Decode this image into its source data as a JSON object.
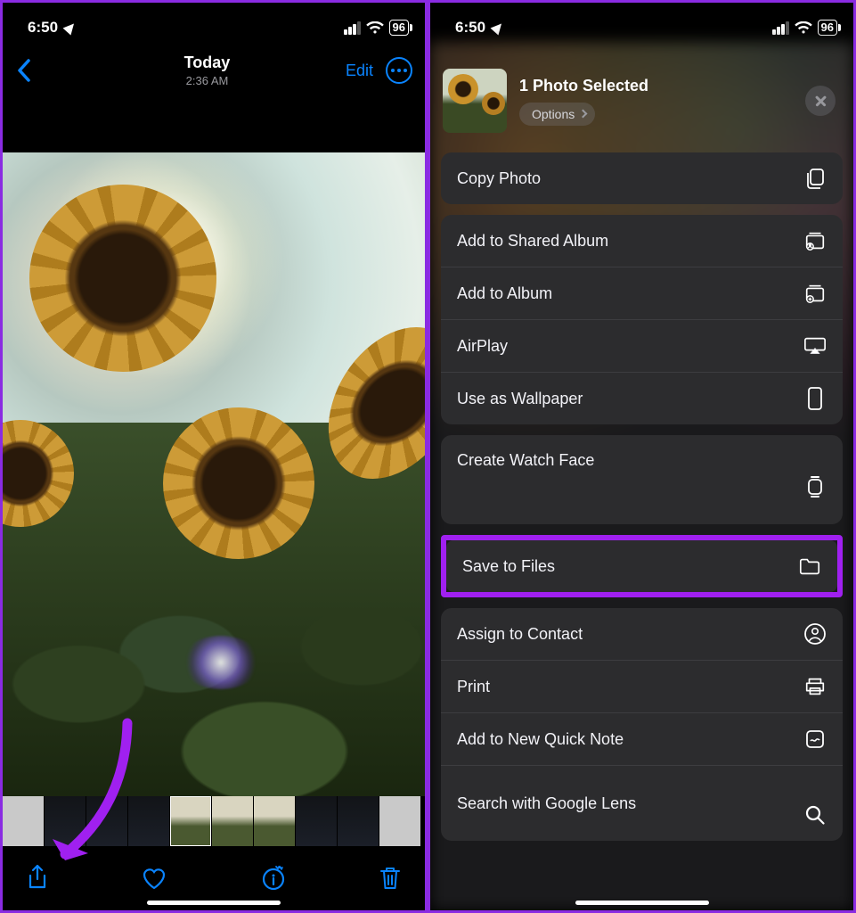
{
  "status": {
    "time": "6:50",
    "battery": "96"
  },
  "left": {
    "title": "Today",
    "subtitle": "2:36 AM",
    "edit": "Edit"
  },
  "share": {
    "title": "1 Photo Selected",
    "options": "Options",
    "actions": {
      "copy": "Copy Photo",
      "shared_album": "Add to Shared Album",
      "album": "Add to Album",
      "airplay": "AirPlay",
      "wallpaper": "Use as Wallpaper",
      "watchface": "Create Watch Face",
      "save_files": "Save to Files",
      "contact": "Assign to Contact",
      "print": "Print",
      "quicknote": "Add to New Quick Note",
      "google_lens": "Search with Google Lens"
    }
  }
}
